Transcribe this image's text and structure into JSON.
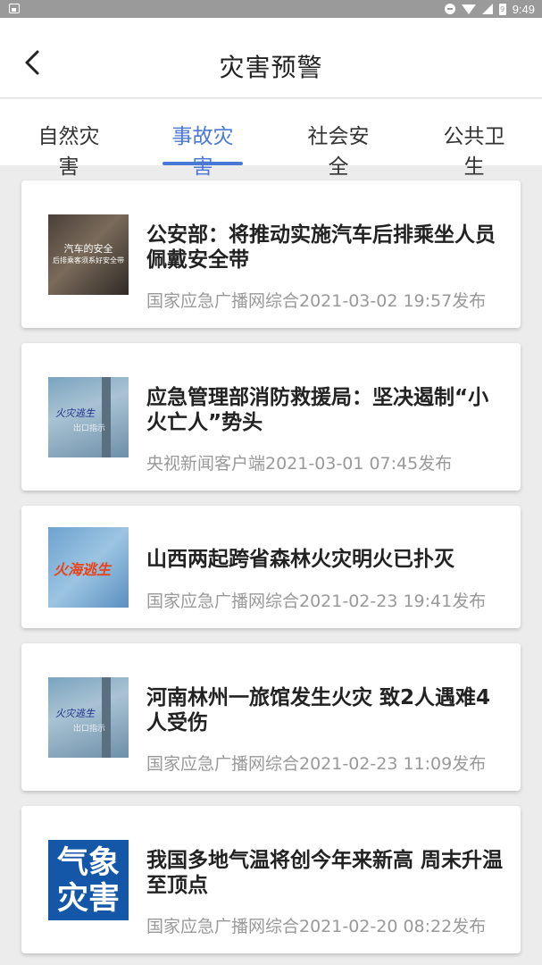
{
  "status_bar": {
    "time": "9:49",
    "battery_level": "9",
    "icons": [
      "notification-image-icon",
      "do-not-disturb-icon",
      "wifi-icon",
      "signal-icon",
      "battery-icon"
    ]
  },
  "header": {
    "title": "灾害预警",
    "back_icon": "chevron-left-icon"
  },
  "tabs": [
    {
      "label": "自然灾害",
      "active": false
    },
    {
      "label": "事故灾害",
      "active": true
    },
    {
      "label": "社会安全",
      "active": false
    },
    {
      "label": "公共卫生",
      "active": false
    }
  ],
  "accent_color": "#4a78d6",
  "articles": [
    {
      "title": "公安部：将推动实施汽车后排乘坐人员佩戴安全带",
      "meta": "国家应急广播网综合2021-03-02 19:57发布",
      "thumb_text": "汽车的安全",
      "thumb_subtext": "后排乘客须系好安全带"
    },
    {
      "title": "应急管理部消防救援局：坚决遏制“小火亡人”势头",
      "meta": "央视新闻客户端2021-03-01 07:45发布",
      "thumb_text": "火灾逃生",
      "thumb_subtext": "出口指示"
    },
    {
      "title": "山西两起跨省森林火灾明火已扑灭",
      "meta": "国家应急广播网综合2021-02-23 19:41发布",
      "thumb_text": "火海逃生"
    },
    {
      "title": "河南林州一旅馆发生火灾 致2人遇难4人受伤",
      "meta": "国家应急广播网综合2021-02-23 11:09发布",
      "thumb_text": "火灾逃生",
      "thumb_subtext": "出口指示"
    },
    {
      "title": "我国多地气温将创今年来新高 周末升温至顶点",
      "meta": "国家应急广播网综合2021-02-20 08:22发布",
      "thumb_text_line1": "气象",
      "thumb_text_line2": "灾害"
    }
  ]
}
